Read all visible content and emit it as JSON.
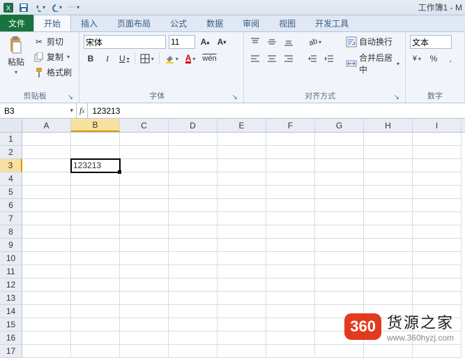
{
  "title": "工作簿1 - M",
  "qat": {
    "save": "保存",
    "undo": "撤销",
    "redo": "重做"
  },
  "tabs": {
    "file": "文件",
    "home": "开始",
    "insert": "插入",
    "layout": "页面布局",
    "formulas": "公式",
    "data": "数据",
    "review": "审阅",
    "view": "视图",
    "dev": "开发工具"
  },
  "clipboard": {
    "paste": "粘贴",
    "cut": "剪切",
    "copy": "复制",
    "format_painter": "格式刷",
    "label": "剪贴板"
  },
  "font": {
    "name": "宋体",
    "size": "11",
    "label": "字体"
  },
  "alignment": {
    "wrap": "自动换行",
    "merge": "合并后居中",
    "label": "对齐方式"
  },
  "number": {
    "format": "文本",
    "label": "数字"
  },
  "namebox_value": "B3",
  "formula_value": "123213",
  "columns": [
    "A",
    "B",
    "C",
    "D",
    "E",
    "F",
    "G",
    "H",
    "I"
  ],
  "rows": [
    "1",
    "2",
    "3",
    "4",
    "5",
    "6",
    "7",
    "8",
    "9",
    "10",
    "11",
    "12",
    "13",
    "14",
    "15",
    "16",
    "17"
  ],
  "active_col": "B",
  "active_row": "3",
  "cells": {
    "B3": "123213"
  },
  "watermark": {
    "logo": "360",
    "text": "货源之家",
    "url": "www.360hyzj.com"
  }
}
